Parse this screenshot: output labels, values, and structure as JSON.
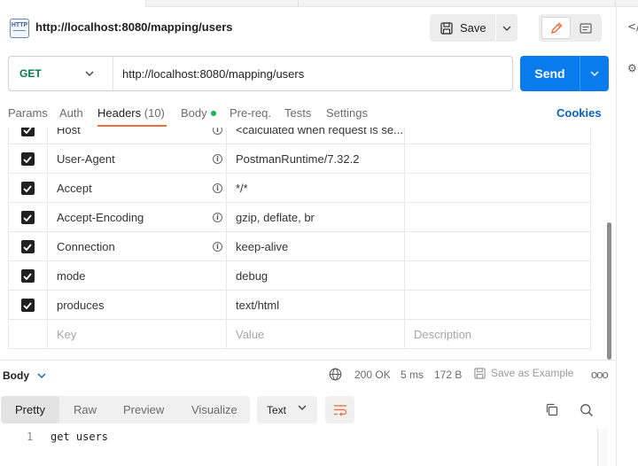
{
  "request": {
    "title": "http://localhost:8080/mapping/users",
    "method": "GET",
    "url": "http://localhost:8080/mapping/users"
  },
  "toolbar": {
    "save_label": "Save",
    "send_label": "Send"
  },
  "req_tabs": [
    {
      "label": "Params"
    },
    {
      "label": "Auth"
    },
    {
      "label": "Headers",
      "count": "(10)"
    },
    {
      "label": "Body"
    },
    {
      "label": "Pre-req."
    },
    {
      "label": "Tests"
    },
    {
      "label": "Settings"
    }
  ],
  "cookies_label": "Cookies",
  "headers": [
    {
      "key": "Host",
      "value": "<calculated when request is se...",
      "checked": true,
      "info": true
    },
    {
      "key": "User-Agent",
      "value": "PostmanRuntime/7.32.2",
      "checked": true,
      "info": true
    },
    {
      "key": "Accept",
      "value": "*/*",
      "checked": true,
      "info": true
    },
    {
      "key": "Accept-Encoding",
      "value": "gzip, deflate, br",
      "checked": true,
      "info": true
    },
    {
      "key": "Connection",
      "value": "keep-alive",
      "checked": true,
      "info": true
    },
    {
      "key": "mode",
      "value": "debug",
      "checked": true,
      "info": false
    },
    {
      "key": "produces",
      "value": "text/html",
      "checked": true,
      "info": false
    }
  ],
  "headers_placeholder": {
    "key": "Key",
    "value": "Value",
    "description": "Description"
  },
  "response": {
    "section_label": "Body",
    "status": "200 OK",
    "time": "5 ms",
    "size": "172 B",
    "save_example_label": "Save as Example",
    "more_label": "ooo",
    "tabs": [
      {
        "label": "Pretty"
      },
      {
        "label": "Raw"
      },
      {
        "label": "Preview"
      },
      {
        "label": "Visualize"
      }
    ],
    "format": "Text",
    "code_lines": [
      {
        "no": "1",
        "text": "get users"
      }
    ]
  },
  "rightbar": {
    "code_icon_label": "</"
  },
  "colors": {
    "accent_orange": "#f26b3a",
    "send_blue": "#097bed",
    "method_green": "#0b7a4b",
    "link_blue": "#0a61c4",
    "dot_green": "#0cbb52"
  }
}
